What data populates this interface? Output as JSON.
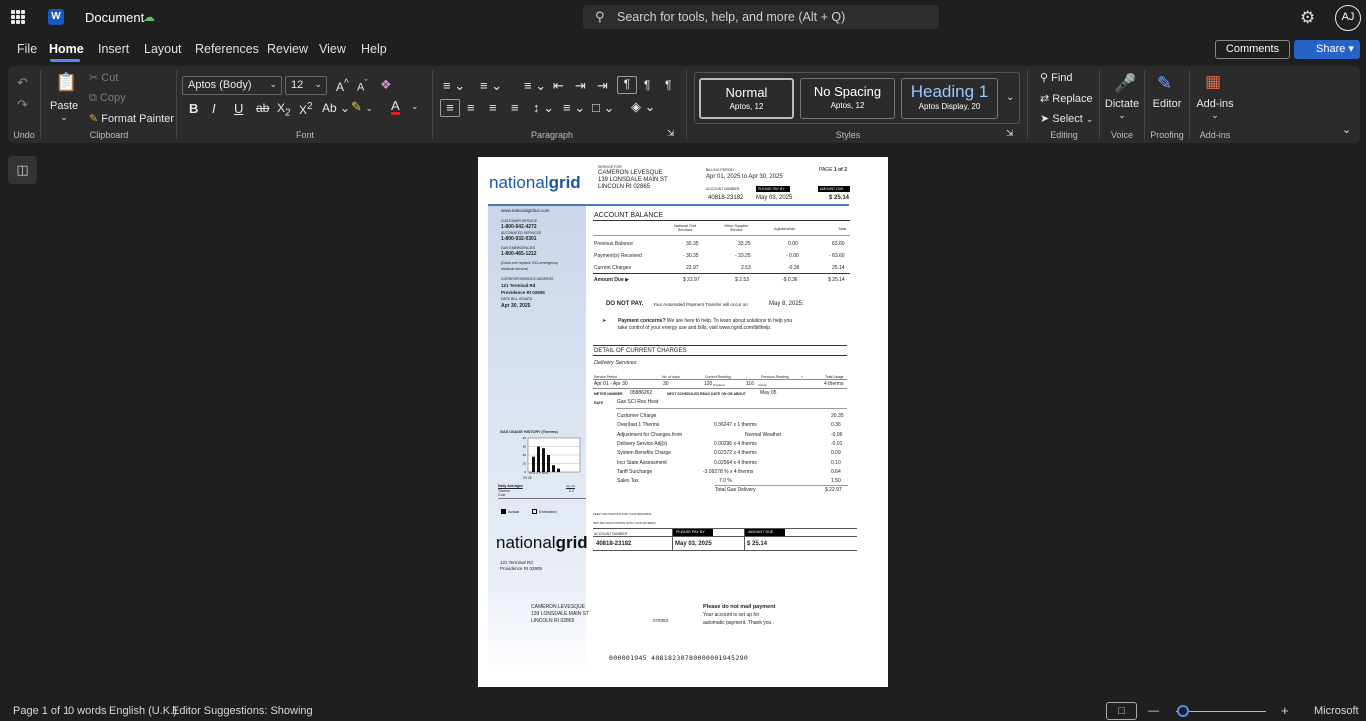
{
  "title_bar": {
    "doc_title": "Document",
    "search_placeholder": "Search for tools, help, and more (Alt + Q)",
    "avatar": "AJ",
    "app_letter": "W"
  },
  "menu": [
    "File",
    "Home",
    "Insert",
    "Layout",
    "References",
    "Review",
    "View",
    "Help"
  ],
  "header_buttons": {
    "comments": "Comments",
    "share": "Share"
  },
  "ribbon": {
    "clipboard": {
      "paste": "Paste",
      "cut": "Cut",
      "copy": "Copy",
      "format_painter": "Format Painter",
      "label": "Clipboard"
    },
    "undo": {
      "label": "Undo"
    },
    "font": {
      "family": "Aptos (Body)",
      "size": "12",
      "label": "Font"
    },
    "paragraph": {
      "label": "Paragraph"
    },
    "styles": {
      "label": "Styles",
      "items": [
        {
          "name": "Normal",
          "desc": "Aptos, 12"
        },
        {
          "name": "No Spacing",
          "desc": "Aptos, 12"
        },
        {
          "name": "Heading 1",
          "desc": "Aptos Display, 20"
        }
      ]
    },
    "editing": {
      "find": "Find",
      "replace": "Replace",
      "select": "Select",
      "label": "Editing"
    },
    "voice": {
      "dictate": "Dictate",
      "label": "Voice"
    },
    "proofing": {
      "editor": "Editor",
      "label": "Proofing"
    },
    "addins": {
      "addins": "Add-ins",
      "label": "Add-ins"
    }
  },
  "bill": {
    "logo_light": "national",
    "logo_bold": "grid",
    "service_for_label": "SERVICE FOR",
    "customer_name": "CAMERON LEVESQUE",
    "customer_addr1": "139 LONSDALE MAIN ST",
    "customer_addr2": "LINCOLN RI 02865",
    "billing_period_label": "BILLING PERIOD",
    "billing_period": "Apr 01, 2025  to Apr 30, 2025",
    "page_label": "PAGE",
    "page_value": "1 of 2",
    "account_number_label": "ACCOUNT NUMBER",
    "account_number": "40818-23182",
    "please_pay_by_label": "PLEASE PAY BY",
    "pay_by_date": "May 03, 2025",
    "amount_due_label": "AMOUNT DUE",
    "amount_due": "$ 25.14",
    "sidebar": {
      "website": "www.nationalgridus.com",
      "cs_label": "CUSTOMER SERVICE",
      "cs_phone": "1-800-642-4272",
      "auto_label": "AUTOMATED SERVICES",
      "auto_phone": "1-800-932-0301",
      "gas_label": "GAS EMERGENCIES",
      "gas_phone": "1-800-465-1212",
      "note": "(Does not replace 911-emergency",
      "note2": "medical service)",
      "corr_label": "CORRESPONDENCE ADDRESS",
      "corr_addr1": "121 Terminal Rd",
      "corr_addr2": "Providence RI 02905",
      "date_issued_label": "DATE BILL ISSUED",
      "date_issued": "Apr 30, 2025"
    },
    "account_balance": {
      "title": "ACCOUNT BALANCE",
      "col1": "National Grid",
      "col1b": "Services",
      "col2": "Other Supplier",
      "col2b": "Service",
      "col3": "Adjustments",
      "col4": "Total",
      "rows": [
        {
          "label": "Previous Balance",
          "v1": "30.35",
          "v2": "33.25",
          "v3": "0.00",
          "v4": "63.60"
        },
        {
          "label": "Payment(s) Received",
          "v1": "- 30.35",
          "v2": "- 33.25",
          "v3": "- 0.00",
          "v4": "- 63.60"
        },
        {
          "label": "Current Charges",
          "v1": "22.97",
          "v2": "2.53",
          "v3": "-0.36",
          "v4": "25.14"
        },
        {
          "label": "Amount Due ▶",
          "v1": "$ 22.97",
          "v2": "$ 2.53",
          "v3": "-$ 0.36",
          "v4": "$ 25.14"
        }
      ]
    },
    "do_not_pay": "DO NOT PAY.",
    "auto_payment": "Your Automated Payment Transfer will occur on",
    "auto_date": "May 8, 2025.",
    "concerns_bold": "Payment concerns?",
    "concerns_text": "We are here to help.  To learn about solutions to help you",
    "concerns_text2": "take control of your energy use and bills, visit www.ngrid.com/billhelp.",
    "detail_title": "DETAIL OF CURRENT CHARGES",
    "delivery": "Delivery Services",
    "svc_head": [
      "Service Period",
      "No. of days",
      "Current Reading",
      "-",
      "Previous Reading",
      "=",
      "Total Usage"
    ],
    "svc_row": [
      "Apr 01 - Apr 30",
      "30",
      "120",
      "Prorated",
      "116",
      "Actual",
      "4 therms"
    ],
    "meter_label": "METER NUMBER",
    "meter": "05886262",
    "next_read_label": "NEXT SCHEDULED READ DATE ON OR ABOUT",
    "next_read": "May 05",
    "rate_label": "RATE",
    "rate": "Gas SCI Res Heat",
    "charges": [
      {
        "label": "Customer Charge",
        "calc": "",
        "amt": "20.35"
      },
      {
        "label": "Over/last 1 Therms",
        "calc": "0.36247  x   1 therms",
        "amt": "0.36"
      },
      {
        "label": "Adjustment for Changes from",
        "calc": "Normal Weather",
        "amt": "-0.06"
      },
      {
        "label": "Delivery Service Adj(s)",
        "calc": "0.00296  x  4 therms",
        "amt": "-0.01"
      },
      {
        "label": "System Benefits Charge",
        "calc": "0.02372  x  4 therms",
        "amt": "0.09"
      },
      {
        "label": "Incr State Assessment",
        "calc": "0.02564  x  4 therms",
        "amt": "0.10"
      },
      {
        "label": "Tariff Surcharge",
        "calc": "-3.09278 %  x  4 therms",
        "amt": "0.64"
      },
      {
        "label": "Sales Tax",
        "calc": "7.0 %",
        "amt": "1.50"
      }
    ],
    "total_label": "Total  Gas Delivery",
    "total": "$ 22.97",
    "gas_history_title": "GAS USAGE HISTORY (Therms)",
    "chart_months": "N D J F M A",
    "chart_nums": "24          25",
    "daily_avg": "Daily Averages",
    "daily_m": "Apr 24",
    "therms": "Therms",
    "therms_v": "0.2",
    "cost": "Cost",
    "legend_actual": "Actual",
    "legend_est": "Estimated",
    "keep_text": "KEEP THIS PORTION FOR YOUR RECORDS.",
    "return_text": "RETURN THIS PORTION WITH YOUR PAYMENT.",
    "stub_addr1": "121 Terminal Rd",
    "stub_addr2": "Providence RI 02905",
    "mail_name": "CAMERON LEVESQUE",
    "mail_addr1": "139 LONSDALE MAIN ST",
    "mail_addr2": "LINCOLN RI 02865",
    "mail_code": "079353",
    "no_mail": "Please do not mail payment",
    "no_mail2": "Your account is set up for",
    "no_mail3": "automatic payment. Thank you .",
    "micr": "000001945  40818230780000001945290"
  },
  "status_bar": {
    "page": "Page 1 of 1",
    "words": "0 words",
    "lang": "English (U.K.)",
    "editor": "Editor Suggestions: Showing",
    "zoom_minus": "—",
    "zoom_plus": "+",
    "microsoft": "Microsoft"
  },
  "chart_data": {
    "type": "bar",
    "title": "GAS USAGE HISTORY (Therms)",
    "categories": [
      "N",
      "D",
      "J",
      "F",
      "M",
      "A"
    ],
    "values": [
      18,
      30,
      28,
      20,
      8,
      4
    ],
    "ylim": [
      0,
      40
    ]
  }
}
